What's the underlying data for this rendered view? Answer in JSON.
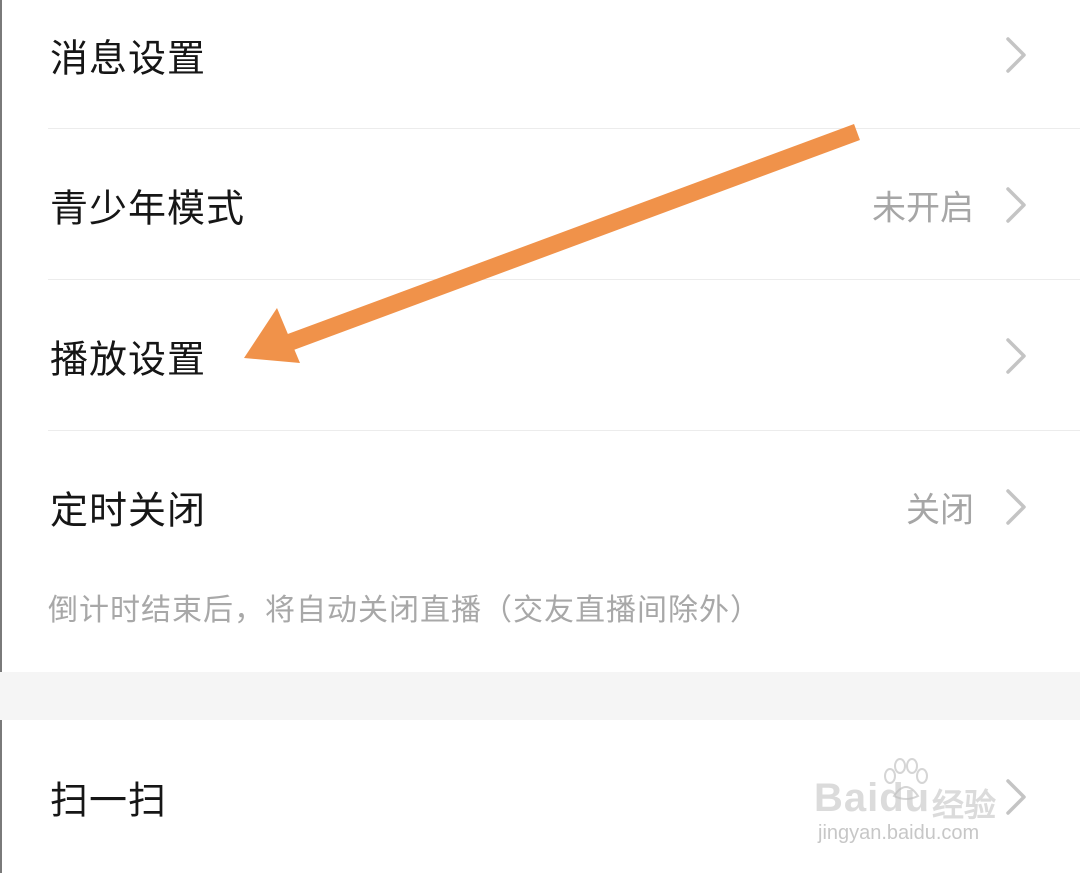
{
  "settings": {
    "message_settings": {
      "label": "消息设置"
    },
    "youth_mode": {
      "label": "青少年模式",
      "value": "未开启"
    },
    "playback_settings": {
      "label": "播放设置"
    },
    "timer_close": {
      "label": "定时关闭",
      "value": "关闭",
      "hint": "倒计时结束后，将自动关闭直播（交友直播间除外）"
    },
    "scan": {
      "label": "扫一扫"
    }
  },
  "icons": {
    "row_chevron": "chevron-right-icon",
    "annotation": "arrow-icon"
  },
  "colors": {
    "annotation_arrow": "#F0924A",
    "label_text": "#161616",
    "secondary_text": "#A6A6A6",
    "section_gap": "#F5F5F5"
  },
  "watermark": {
    "brand": "Baidu",
    "cn": "经验",
    "url": "jingyan.baidu.com"
  }
}
